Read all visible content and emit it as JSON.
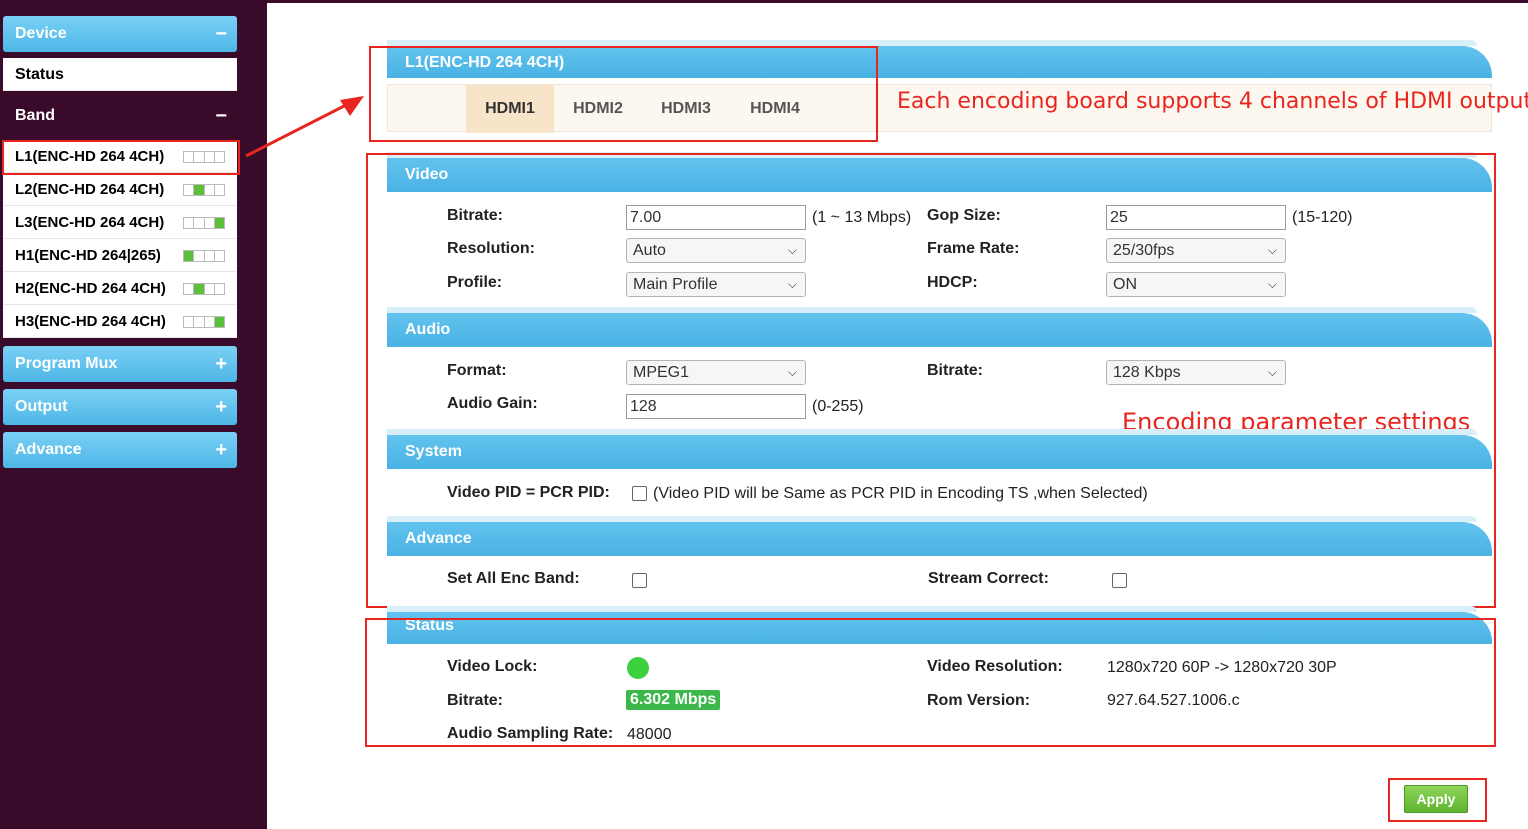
{
  "sidebar": {
    "device": {
      "label": "Device",
      "sign": "−"
    },
    "status": {
      "label": "Status"
    },
    "band": {
      "label": "Band",
      "sign": "−"
    },
    "boards": [
      {
        "label": "L1(ENC-HD 264 4CH)",
        "channels": [
          false,
          false,
          false,
          false
        ]
      },
      {
        "label": "L2(ENC-HD 264 4CH)",
        "channels": [
          false,
          true,
          false,
          false
        ]
      },
      {
        "label": "L3(ENC-HD 264 4CH)",
        "channels": [
          false,
          false,
          false,
          true
        ]
      },
      {
        "label": "H1(ENC-HD 264|265)",
        "channels": [
          true,
          false,
          false,
          false
        ]
      },
      {
        "label": "H2(ENC-HD 264 4CH)",
        "channels": [
          false,
          true,
          false,
          false
        ]
      },
      {
        "label": "H3(ENC-HD 264 4CH)",
        "channels": [
          false,
          false,
          false,
          true
        ]
      }
    ],
    "program_mux": {
      "label": "Program Mux",
      "sign": "+"
    },
    "output": {
      "label": "Output",
      "sign": "+"
    },
    "advance": {
      "label": "Advance",
      "sign": "+"
    }
  },
  "board": {
    "title": "L1(ENC-HD 264 4CH)",
    "tabs": [
      "HDMI1",
      "HDMI2",
      "HDMI3",
      "HDMI4"
    ],
    "active_tab": "HDMI1"
  },
  "annotations": {
    "tabs_note": "Each encoding board supports 4 channels of HDMI output",
    "params_note": "Encoding parameter settings"
  },
  "video": {
    "title": "Video",
    "bitrate_label": "Bitrate:",
    "bitrate_value": "7.00",
    "bitrate_hint": "(1 ~ 13 Mbps)",
    "gop_label": "Gop Size:",
    "gop_value": "25",
    "gop_hint": "(15-120)",
    "resolution_label": "Resolution:",
    "resolution_value": "Auto",
    "frame_rate_label": "Frame Rate:",
    "frame_rate_value": "25/30fps",
    "profile_label": "Profile:",
    "profile_value": "Main Profile",
    "hdcp_label": "HDCP:",
    "hdcp_value": "ON"
  },
  "audio": {
    "title": "Audio",
    "format_label": "Format:",
    "format_value": "MPEG1",
    "bitrate_label": "Bitrate:",
    "bitrate_value": "128 Kbps",
    "gain_label": "Audio Gain:",
    "gain_value": "128",
    "gain_hint": "(0-255)"
  },
  "system": {
    "title": "System",
    "pid_label": "Video PID = PCR PID:",
    "pid_hint": "(Video PID will be Same as PCR PID in Encoding TS ,when Selected)"
  },
  "advance": {
    "title": "Advance",
    "set_all_label": "Set All Enc Band:",
    "stream_correct_label": "Stream Correct:"
  },
  "status": {
    "title": "Status",
    "video_lock_label": "Video Lock:",
    "video_resolution_label": "Video Resolution:",
    "video_resolution_value": "1280x720 60P -> 1280x720 30P",
    "bitrate_label": "Bitrate:",
    "bitrate_value": "6.302 Mbps",
    "rom_label": "Rom Version:",
    "rom_value": "927.64.527.1006.c",
    "audio_rate_label": "Audio Sampling Rate:",
    "audio_rate_value": "48000"
  },
  "apply_label": "Apply",
  "colors": {
    "sidebar_bg": "#3a0a2a",
    "section_blue": "#4ab2e4",
    "annotation_red": "#e8261f",
    "led_green": "#3dd23d",
    "apply_green": "#5fb42f"
  }
}
